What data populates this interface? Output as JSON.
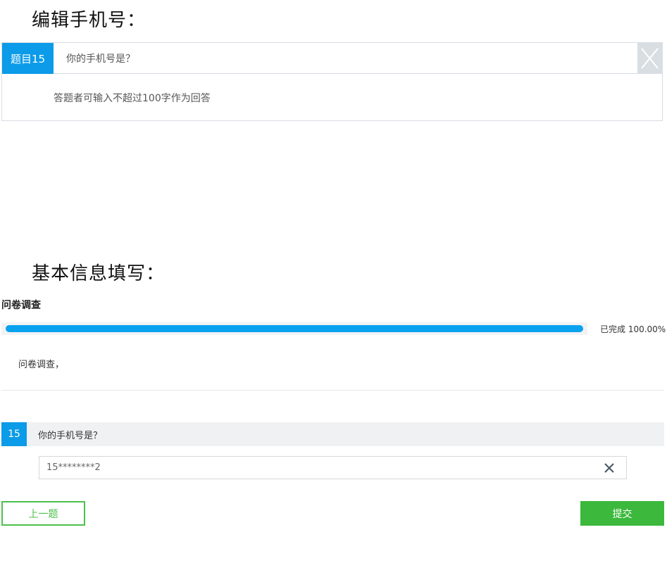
{
  "section_titles": {
    "edit": "编辑手机号：",
    "basic": "基本信息填写："
  },
  "editor": {
    "badge": "题目15",
    "question": "你的手机号是？",
    "hint": "答题者可输入不超过100字作为回答",
    "close_icon": "close-icon"
  },
  "survey": {
    "title": "问卷调查",
    "progress_value": 100,
    "progress_text": "已完成 100.00%",
    "description": "问卷调查，"
  },
  "question": {
    "number": "15",
    "text": "你的手机号是？",
    "answer_value": "15********2",
    "clear_icon": "clear-x-icon"
  },
  "buttons": {
    "prev": "上一题",
    "submit": "提交"
  },
  "colors": {
    "accent_blue": "#0b9be8",
    "progress_blue": "#0aa2ee",
    "green": "#3cb83c"
  }
}
